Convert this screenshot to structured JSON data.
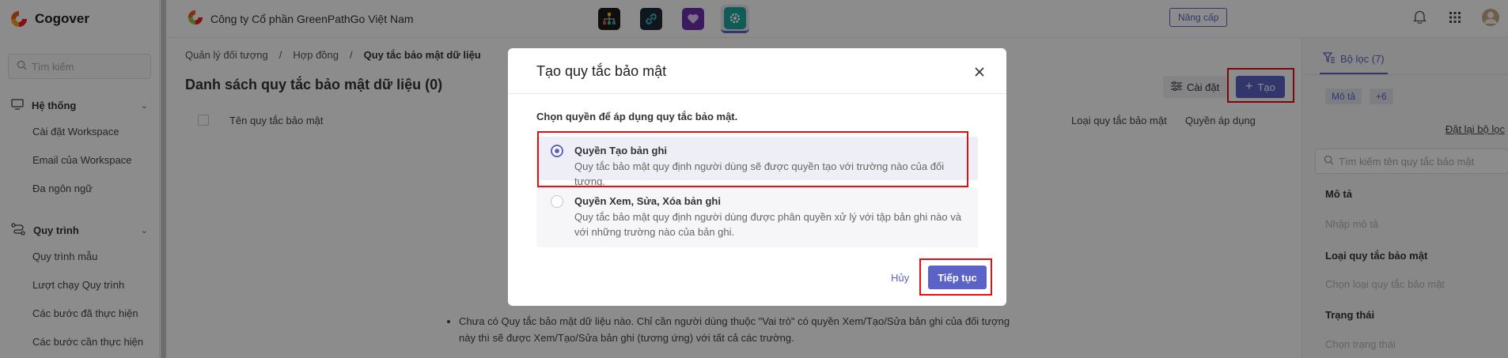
{
  "sidebar": {
    "app_name": "Cogover",
    "search_placeholder": "Tìm kiếm",
    "sections": [
      {
        "label": "Hệ thống",
        "items": [
          "Cài đặt Workspace",
          "Email của Workspace",
          "Đa ngôn ngữ"
        ]
      },
      {
        "label": "Quy trình",
        "items": [
          "Quy trình mẫu",
          "Lượt chạy Quy trình",
          "Các bước đã thực hiện",
          "Các bước cần thực hiện"
        ]
      }
    ]
  },
  "topbar": {
    "company": "Công ty Cổ phần GreenPathGo Việt Nam",
    "upgrade_label": "Nâng cấp"
  },
  "main": {
    "breadcrumb": [
      "Quản lý đối tượng",
      "Hợp đồng",
      "Quy tắc bảo mật dữ liệu"
    ],
    "title": "Danh sách quy tắc bảo mật dữ liệu (0)",
    "settings_label": "Cài đặt",
    "create_label": "Tạo",
    "columns": [
      "Tên quy tắc bảo mật",
      "Loại quy tắc bảo mật",
      "Quyền áp dụng"
    ],
    "empty_note_1": "Chưa có Quy tắc bảo mật dữ liệu nào. Chỉ cần người dùng thuộc \"Vai trò\" có quyền Xem/Tạo/Sửa bản ghi của đối tượng này thì sẽ được Xem/Tạo/Sửa bản ghi (tương ứng) với tất cả các trường."
  },
  "filter_panel": {
    "tab_label": "Bộ lọc (7)",
    "chip_1": "Mô tả",
    "chip_2": "+6",
    "reset_label": "Đặt lại bộ lọc",
    "search_placeholder": "Tìm kiếm tên quy tắc bảo mật",
    "fields": [
      {
        "label": "Mô tả",
        "placeholder": "Nhập mô tả"
      },
      {
        "label": "Loại quy tắc bảo mật",
        "placeholder": "Chọn loại quy tắc bảo mật"
      },
      {
        "label": "Trạng thái",
        "placeholder": "Chọn trạng thái"
      }
    ]
  },
  "modal": {
    "title": "Tạo quy tắc bảo mật",
    "prompt": "Chọn quyền để áp dụng quy tắc bảo mật.",
    "options": [
      {
        "title": "Quyền Tạo bản ghi",
        "desc": "Quy tắc bảo mật quy định người dùng sẽ được quyền tạo với trường nào của đối tượng.",
        "selected": true
      },
      {
        "title": "Quyền Xem, Sửa, Xóa bản ghi",
        "desc": "Quy tắc bảo mật quy định người dùng được phân quyền xử lý với tập bản ghi nào và với những trường nào của bản ghi.",
        "selected": false
      }
    ],
    "cancel_label": "Hủy",
    "continue_label": "Tiếp tục"
  },
  "colors": {
    "accent": "#5b63c7",
    "highlight": "#e01010"
  }
}
